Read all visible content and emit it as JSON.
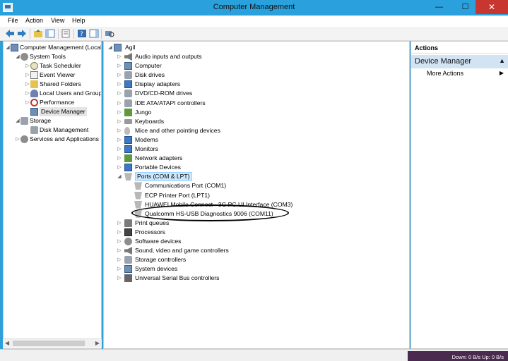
{
  "window": {
    "title": "Computer Management",
    "minimize": "—",
    "maximize": "☐",
    "close": "✕"
  },
  "menu": [
    "File",
    "Action",
    "View",
    "Help"
  ],
  "left_tree": [
    {
      "label": "Computer Management (Local",
      "level": 0,
      "exp": "◢",
      "icon": "ic-pc"
    },
    {
      "label": "System Tools",
      "level": 1,
      "exp": "◢",
      "icon": "ic-gear"
    },
    {
      "label": "Task Scheduler",
      "level": 2,
      "exp": "▷",
      "icon": "ic-clock"
    },
    {
      "label": "Event Viewer",
      "level": 2,
      "exp": "▷",
      "icon": "ic-log"
    },
    {
      "label": "Shared Folders",
      "level": 2,
      "exp": "▷",
      "icon": "ic-folder"
    },
    {
      "label": "Local Users and Groups",
      "level": 2,
      "exp": "▷",
      "icon": "ic-users"
    },
    {
      "label": "Performance",
      "level": 2,
      "exp": "▷",
      "icon": "ic-perf"
    },
    {
      "label": "Device Manager",
      "level": 2,
      "exp": "",
      "icon": "ic-pc",
      "selected": true
    },
    {
      "label": "Storage",
      "level": 1,
      "exp": "◢",
      "icon": "ic-disk"
    },
    {
      "label": "Disk Management",
      "level": 2,
      "exp": "",
      "icon": "ic-disk"
    },
    {
      "label": "Services and Applications",
      "level": 1,
      "exp": "▷",
      "icon": "ic-gear"
    }
  ],
  "device_tree": {
    "root": "Agil",
    "categories": [
      {
        "label": "Audio inputs and outputs",
        "icon": "ic-speaker"
      },
      {
        "label": "Computer",
        "icon": "ic-pc"
      },
      {
        "label": "Disk drives",
        "icon": "ic-disk"
      },
      {
        "label": "Display adapters",
        "icon": "ic-mon"
      },
      {
        "label": "DVD/CD-ROM drives",
        "icon": "ic-disk"
      },
      {
        "label": "IDE ATA/ATAPI controllers",
        "icon": "ic-disk"
      },
      {
        "label": "Jungo",
        "icon": "ic-net"
      },
      {
        "label": "Keyboards",
        "icon": "ic-kb"
      },
      {
        "label": "Mice and other pointing devices",
        "icon": "ic-mouse"
      },
      {
        "label": "Modems",
        "icon": "ic-mon"
      },
      {
        "label": "Monitors",
        "icon": "ic-mon"
      },
      {
        "label": "Network adapters",
        "icon": "ic-net"
      },
      {
        "label": "Portable Devices",
        "icon": "ic-mon"
      },
      {
        "label": "Ports (COM & LPT)",
        "icon": "ic-port",
        "expanded": true,
        "highlighted": true,
        "children": [
          "Communications Port (COM1)",
          "ECP Printer Port (LPT1)",
          "HUAWEI Mobile Connect - 3G PC UI Interface (COM3)",
          "Qualcomm HS-USB Diagnostics 9006 (COM11)"
        ]
      },
      {
        "label": "Print queues",
        "icon": "ic-printer"
      },
      {
        "label": "Processors",
        "icon": "ic-cpu"
      },
      {
        "label": "Software devices",
        "icon": "ic-gear"
      },
      {
        "label": "Sound, video and game controllers",
        "icon": "ic-speaker"
      },
      {
        "label": "Storage controllers",
        "icon": "ic-disk"
      },
      {
        "label": "System devices",
        "icon": "ic-pc"
      },
      {
        "label": "Universal Serial Bus controllers",
        "icon": "ic-usb"
      }
    ]
  },
  "actions": {
    "header": "Actions",
    "group": "Device Manager",
    "group_arrow": "▲",
    "more": "More Actions",
    "more_arrow": "▶"
  },
  "status": {
    "net": "Down: 0 B/s  Up: 0 B/s"
  }
}
